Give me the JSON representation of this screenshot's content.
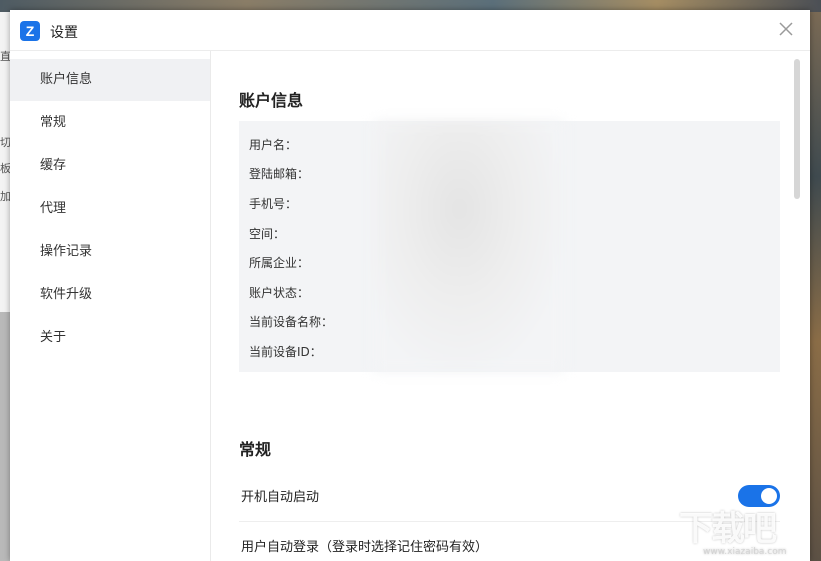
{
  "window": {
    "title": "设置",
    "logo_letter": "Z"
  },
  "background_fragments": [
    "直",
    "切",
    "板",
    "加"
  ],
  "sidebar": {
    "items": [
      {
        "label": "账户信息",
        "active": true
      },
      {
        "label": "常规"
      },
      {
        "label": "缓存"
      },
      {
        "label": "代理"
      },
      {
        "label": "操作记录"
      },
      {
        "label": "软件升级"
      },
      {
        "label": "关于"
      }
    ]
  },
  "account": {
    "title": "账户信息",
    "fields": [
      "用户名：",
      "登陆邮箱：",
      "手机号：",
      "空间：",
      "所属企业：",
      "账户状态：",
      "当前设备名称：",
      "当前设备ID："
    ]
  },
  "general": {
    "title": "常规",
    "settings": [
      {
        "label": "开机自动启动",
        "toggle_on": true
      },
      {
        "label": "用户自动登录（登录时选择记住密码有效）"
      }
    ]
  },
  "watermark": {
    "text": "下载吧",
    "sub": "www.xiazaiba.com"
  },
  "colors": {
    "accent": "#1a73e8",
    "active_bg": "#f0f1f3",
    "panel_bg": "#f3f4f6"
  }
}
